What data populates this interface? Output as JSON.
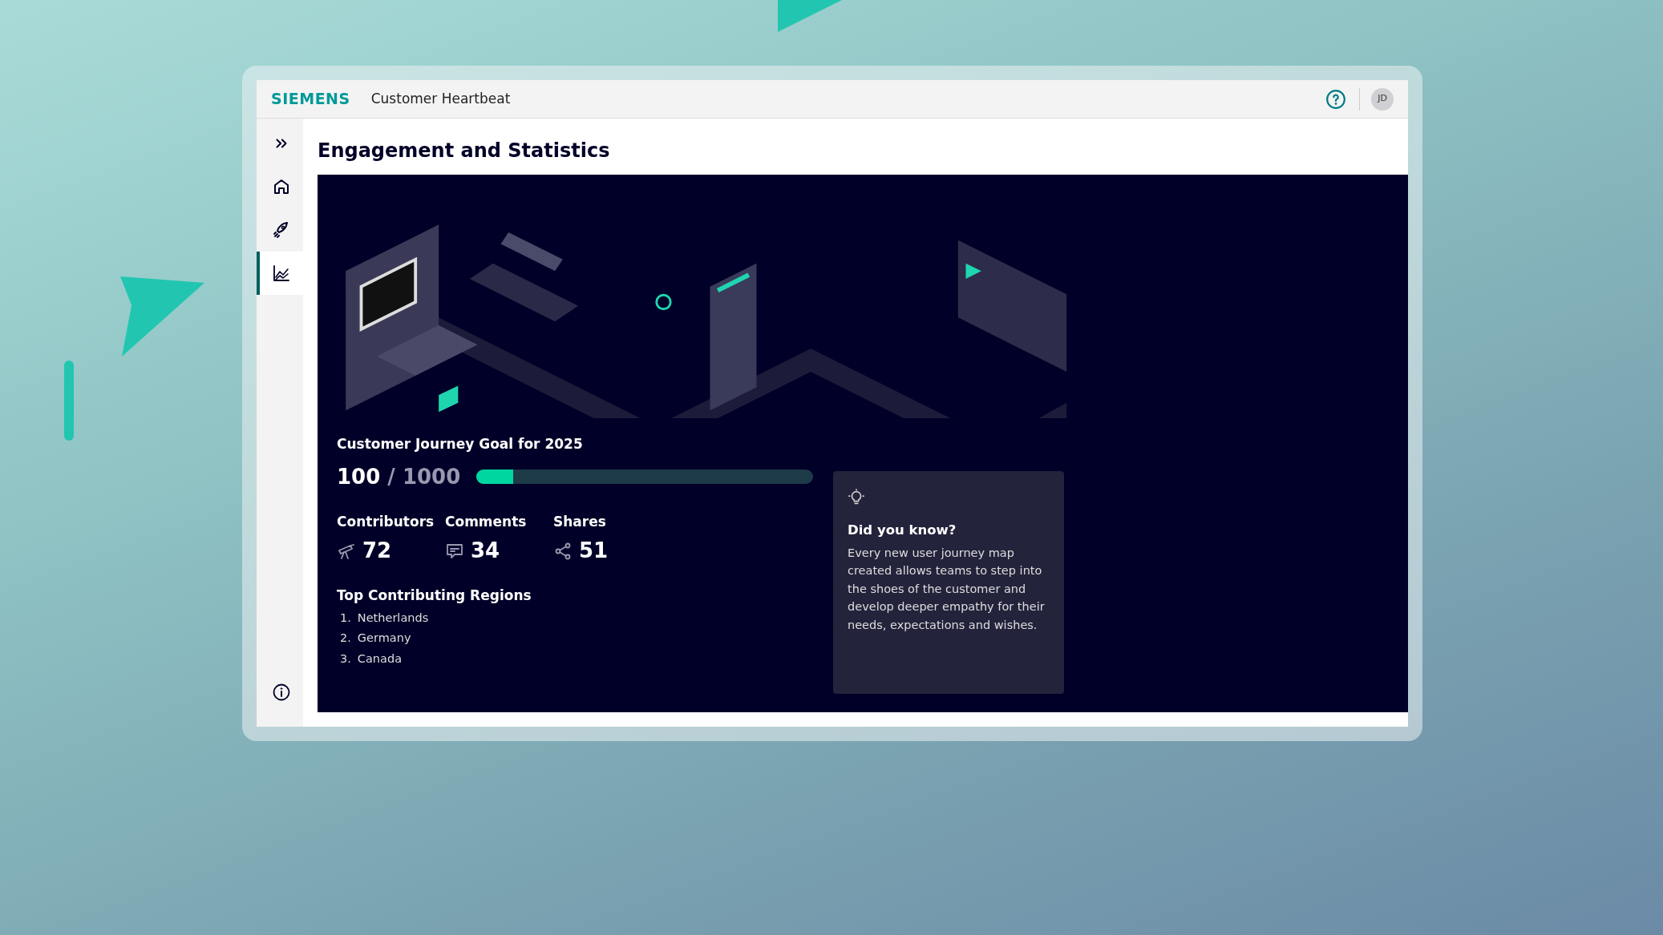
{
  "header": {
    "logo": "SIEMENS",
    "app_title": "Customer Heartbeat",
    "avatar": "JD"
  },
  "sidebar": {
    "items": [
      {
        "kind": "home",
        "selected": false
      },
      {
        "kind": "rocket",
        "selected": false
      },
      {
        "kind": "chart",
        "selected": true
      }
    ]
  },
  "page_title": "Engagement and Statistics",
  "goal": {
    "title": "Customer Journey Goal for 2025",
    "current": "100",
    "total": "/ 1000",
    "level": 0.11
  },
  "stats": [
    {
      "kind": "contributors",
      "label": "Contributors",
      "value": "72"
    },
    {
      "kind": "comments",
      "label": "Comments",
      "value": "34"
    },
    {
      "kind": "shares",
      "label": "Shares",
      "value": "51"
    }
  ],
  "regions": {
    "title": "Top Contributing Regions",
    "items": [
      {
        "number": "1.",
        "name": "Netherlands"
      },
      {
        "number": "2.",
        "name": "Germany"
      },
      {
        "number": "3.",
        "name": "Canada"
      }
    ]
  },
  "tip": {
    "title": "Did you know?",
    "text": "Every new user journey map created allows teams to step into the shoes of the customer and develop deeper empathy for their needs, expectations and wishes."
  }
}
